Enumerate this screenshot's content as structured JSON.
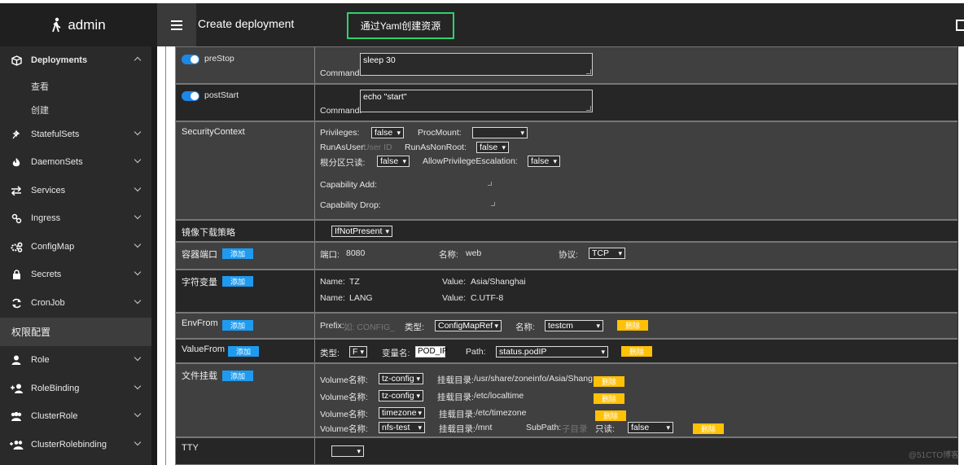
{
  "brand": {
    "name": "admin"
  },
  "header": {
    "title": "Create deployment",
    "yaml_button": "通过Yaml创建资源"
  },
  "sidebar": {
    "items": [
      {
        "label": "Deployments",
        "icon": "cube-icon"
      },
      {
        "label": "StatefulSets",
        "icon": "sparkle-icon"
      },
      {
        "label": "DaemonSets",
        "icon": "flame-icon"
      },
      {
        "label": "Services",
        "icon": "swap-icon"
      },
      {
        "label": "Ingress",
        "icon": "link-icon"
      },
      {
        "label": "ConfigMap",
        "icon": "gears-icon"
      },
      {
        "label": "Secrets",
        "icon": "lock-icon"
      },
      {
        "label": "CronJob",
        "icon": "refresh-icon"
      }
    ],
    "deployments_sub": [
      "查看",
      "创建"
    ],
    "section": "权限配置",
    "section_items": [
      {
        "label": "Role",
        "icon": "user-icon"
      },
      {
        "label": "RoleBinding",
        "icon": "user-plus-icon"
      },
      {
        "label": "ClusterRole",
        "icon": "users-icon"
      },
      {
        "label": "ClusterRolebinding",
        "icon": "users-plus-icon"
      }
    ]
  },
  "form": {
    "prestop": {
      "label": "preStop",
      "command_label": "Command:",
      "command": "sleep 30"
    },
    "poststart": {
      "label": "postStart",
      "command_label": "Command:",
      "command": "echo \"start\""
    },
    "security": {
      "label": "SecurityContext",
      "privileges_label": "Privileges:",
      "privileges": "false",
      "procmount_label": "ProcMount:",
      "procmount": "",
      "runasuser_label": "RunAsUser:",
      "runasuser_placeholder": "User ID",
      "runasnonroot_label": "RunAsNonRoot:",
      "runasnonroot": "false",
      "readonly_label": "根分区只读:",
      "readonly": "false",
      "allowpe_label": "AllowPrivilegeEscalation:",
      "allowpe": "false",
      "capadd_label": "Capability Add:",
      "capdrop_label": "Capability Drop:"
    },
    "pullpolicy": {
      "label": "镜像下载策略",
      "value": "IfNotPresent"
    },
    "ports": {
      "label": "容器端口",
      "add": "添加",
      "port_label": "端口:",
      "port": "8080",
      "name_label": "名称:",
      "name": "web",
      "proto_label": "协议:",
      "proto": "TCP"
    },
    "env": {
      "label": "字符变量",
      "add": "添加",
      "items": [
        {
          "name_label": "Name:",
          "name": "TZ",
          "value_label": "Value:",
          "value": "Asia/Shanghai"
        },
        {
          "name_label": "Name:",
          "name": "LANG",
          "value_label": "Value:",
          "value": "C.UTF-8"
        }
      ]
    },
    "envfrom": {
      "label": "EnvFrom",
      "add": "添加",
      "prefix_label": "Prefix:",
      "prefix_placeholder": "如: CONFIG_",
      "type_label": "类型:",
      "type": "ConfigMapRef",
      "name_label": "名称:",
      "name": "testcm",
      "del": "删除"
    },
    "valuefrom": {
      "label": "ValueFrom",
      "add": "添加",
      "type_label": "类型:",
      "type": "F",
      "var_label": "变量名:",
      "var": "POD_IP",
      "path_label": "Path:",
      "path": "status.podIP",
      "del": "删除"
    },
    "volumes": {
      "label": "文件挂载",
      "add": "添加",
      "items": [
        {
          "vol_label": "Volume名称:",
          "vol": "tz-config",
          "mount_label": "挂载目录:",
          "mount": "/usr/share/zoneinfo/Asia/Shangh",
          "del": "删除"
        },
        {
          "vol_label": "Volume名称:",
          "vol": "tz-config",
          "mount_label": "挂载目录:",
          "mount": "/etc/localtime",
          "del": "删除"
        },
        {
          "vol_label": "Volume名称:",
          "vol": "timezone",
          "mount_label": "挂载目录:",
          "mount": "/etc/timezone",
          "del": "删除"
        },
        {
          "vol_label": "Volume名称:",
          "vol": "nfs-test",
          "mount_label": "挂载目录:",
          "mount": "/mnt",
          "subpath_label": "SubPath:",
          "subpath_placeholder": "子目录",
          "ro_label": "只读:",
          "ro": "false",
          "del": "删除"
        }
      ]
    },
    "tty": {
      "label": "TTY",
      "value": ""
    }
  },
  "watermark": "@51CTO博客"
}
